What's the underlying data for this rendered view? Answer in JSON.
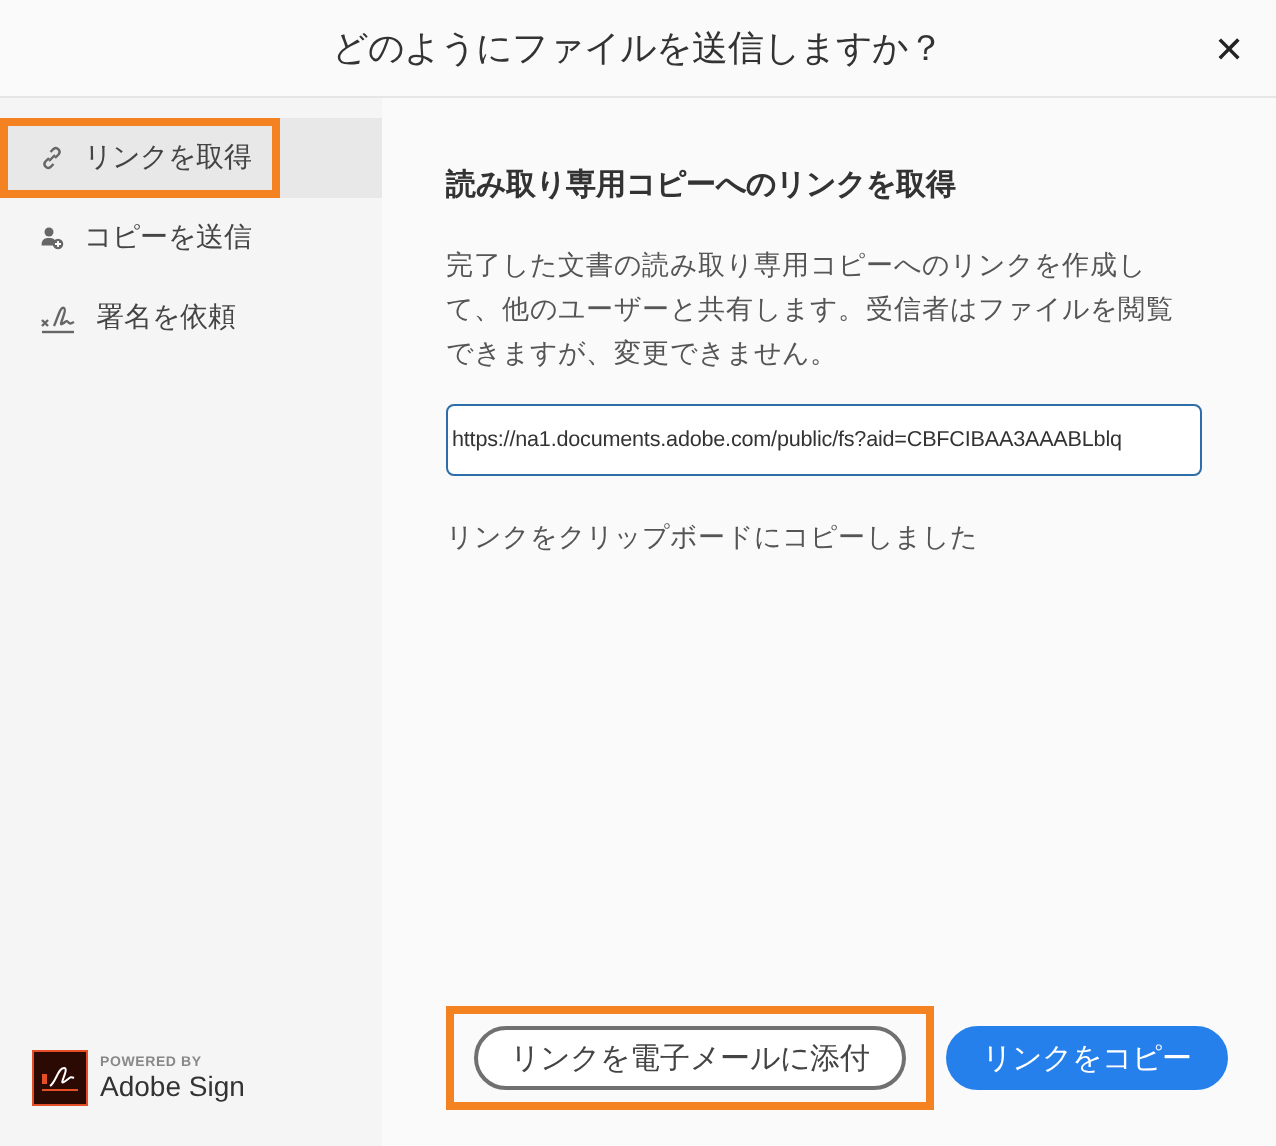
{
  "dialog": {
    "title": "どのようにファイルを送信しますか？",
    "close": "✕"
  },
  "sidebar": {
    "items": [
      {
        "kind": "link",
        "label": "リンクを取得",
        "selected": true,
        "highlighted": true
      },
      {
        "kind": "send",
        "label": "コピーを送信",
        "selected": false,
        "highlighted": false
      },
      {
        "kind": "sign",
        "label": "署名を依頼",
        "selected": false,
        "highlighted": false
      }
    ],
    "branding": {
      "caption": "POWERED BY",
      "product": "Adobe Sign"
    }
  },
  "content": {
    "heading": "読み取り専用コピーへのリンクを取得",
    "description": "完了した文書の読み取り専用コピーへのリンクを作成して、他のユーザーと共有します。受信者はファイルを閲覧できますが、変更できません。",
    "link_field": {
      "value": "https://na1.documents.adobe.com/public/fs?aid=CBFCIBAA3AAABLblq"
    },
    "status": "リンクをクリップボードにコピーしました"
  },
  "buttons": [
    {
      "kind": "secondary",
      "label": "リンクを電子メールに添付",
      "highlighted": true
    },
    {
      "kind": "primary",
      "label": "リンクをコピー",
      "highlighted": false
    }
  ]
}
